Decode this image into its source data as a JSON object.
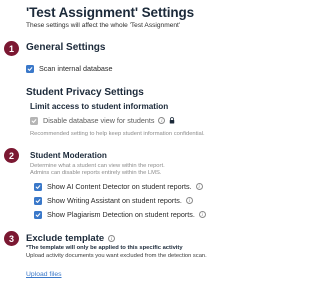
{
  "header": {
    "title": "'Test Assignment' Settings",
    "subtitle": "These settings will affect the whole 'Test Assignment'"
  },
  "badges": [
    "1",
    "2",
    "3"
  ],
  "general": {
    "heading": "General Settings",
    "scan_label": "Scan internal database",
    "scan_checked": true
  },
  "privacy": {
    "heading": "Student Privacy Settings",
    "limit_heading": "Limit access to student information",
    "disable_label": "Disable database view for students",
    "disable_checked": true,
    "recommendation": "Recommended setting to help keep student information confidential."
  },
  "moderation": {
    "heading": "Student Moderation",
    "description_line1": "Determine what a student can view within the report.",
    "description_line2": "Admins can disable reports entirely within the LMS.",
    "options": [
      {
        "label": "Show AI Content Detector on student reports.",
        "checked": true
      },
      {
        "label": "Show Writing Assistant on student reports.",
        "checked": true
      },
      {
        "label": "Show Plagiarism Detection on student reports.",
        "checked": true
      }
    ]
  },
  "exclude": {
    "heading": "Exclude template",
    "note_bold": "*The template will only be applied to this specific activity",
    "note": "Upload activity documents you want excluded from the detection scan.",
    "upload_label": "Upload files"
  },
  "colors": {
    "badge": "#7b1832",
    "checkbox": "#3a78c9",
    "checkbox_disabled": "#b5b5b5",
    "link": "#3a78c9"
  }
}
